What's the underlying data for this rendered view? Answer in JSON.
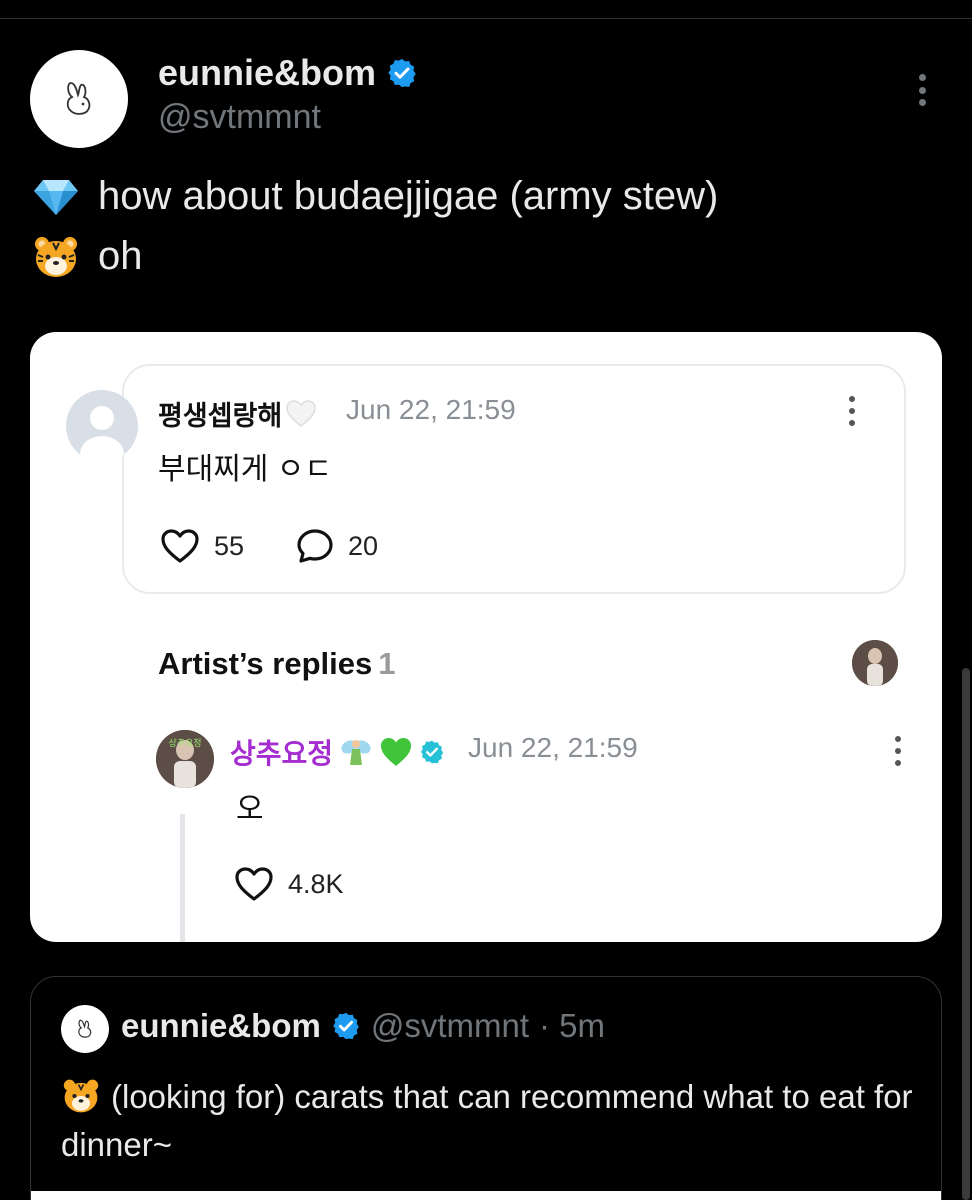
{
  "post": {
    "display_name": "eunnie&bom",
    "handle": "@svtmmnt",
    "lines": [
      {
        "emoji": "gem-icon",
        "text": "how about budaejjigae (army stew)"
      },
      {
        "emoji": "tiger-face-icon",
        "text": "oh"
      }
    ]
  },
  "embedded": {
    "comment": {
      "author": "평생셉랑해",
      "date": "Jun 22, 21:59",
      "text": "부대찌게 ㅇㄷ",
      "likes": "55",
      "replies": "20"
    },
    "artist_replies": {
      "title": "Artist’s replies",
      "count": "1"
    },
    "reply": {
      "author": "상추요정",
      "date": "Jun 22, 21:59",
      "text": "오",
      "likes": "4.8K"
    }
  },
  "quote": {
    "display_name": "eunnie&bom",
    "handle": "@svtmmnt",
    "time": "· 5m",
    "text": "(looking for) carats that can recommend what to eat for dinner~"
  },
  "colors": {
    "background": "#000000",
    "verified": "#1d9bf0",
    "artist_name": "#a42cd0",
    "muted": "#71767b"
  }
}
